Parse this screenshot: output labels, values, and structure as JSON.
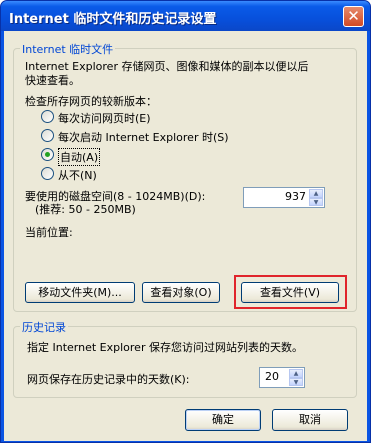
{
  "window": {
    "title": "Internet 临时文件和历史记录设置",
    "close_glyph": "✕"
  },
  "temp_files": {
    "legend": "Internet 临时文件",
    "description_line1": "Internet Explorer 存储网页、图像和媒体的副本以便以后",
    "description_line2": "快速查看。",
    "check_label": "检查所存网页的较新版本：",
    "options": [
      {
        "label": "每次访问网页时(E)",
        "selected": false
      },
      {
        "label": "每次启动 Internet Explorer 时(S)",
        "selected": false
      },
      {
        "label": "自动(A)",
        "selected": true
      },
      {
        "label": "从不(N)",
        "selected": false
      }
    ],
    "disk_label_line1": "要使用的磁盘空间(8 - 1024MB)(D):",
    "disk_label_line2": "(推荐: 50 - 250MB)",
    "disk_value": "937",
    "current_location_label": "当前位置:",
    "move_folder_label": "移动文件夹(M)...",
    "view_objects_label": "查看对象(O)",
    "view_files_label": "查看文件(V)"
  },
  "history": {
    "legend": "历史记录",
    "description": "指定 Internet Explorer 保存您访问过网站列表的天数。",
    "days_label": "网页保存在历史记录中的天数(K):",
    "days_value": "20"
  },
  "footer": {
    "ok_label": "确定",
    "cancel_label": "取消"
  }
}
